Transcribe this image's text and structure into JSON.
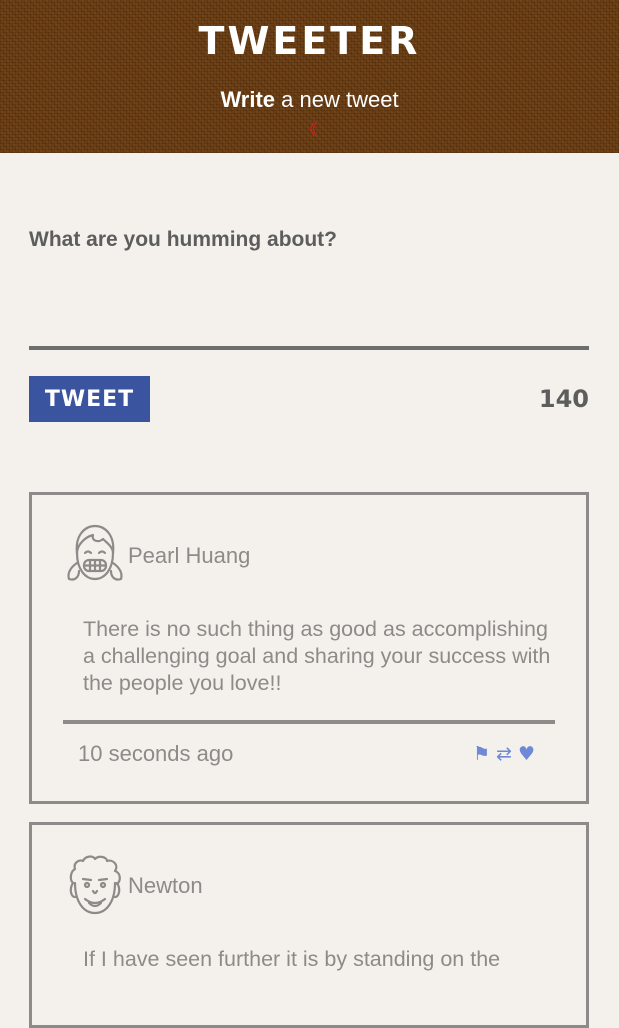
{
  "app": {
    "title": "TWEETER"
  },
  "compose_toggle": {
    "bold": "Write",
    "rest": " a new tweet",
    "arrow_icon": "chevron-double-down"
  },
  "composer": {
    "prompt": "What are you humming about?",
    "placeholder": "",
    "value": "",
    "submit_label": "TWEET",
    "counter": "140"
  },
  "colors": {
    "header_bg": "#6b3d12",
    "page_bg": "#f4f1ec",
    "button_bg": "#3b54a0",
    "action_icon": "#6f89d6",
    "arrow": "#e11d1d",
    "card_border": "#8d8b89"
  },
  "tweets": [
    {
      "author": "Pearl Huang",
      "avatar_icon": "girl-avatar-icon",
      "text": "There is no such thing as good as accomplishing a challenging goal and sharing your success with the people you love!!",
      "time": "10 seconds ago",
      "actions": [
        "flag-icon",
        "retweet-icon",
        "heart-icon"
      ]
    },
    {
      "author": "Newton",
      "avatar_icon": "newton-avatar-icon",
      "text": "If I have seen further it is by standing on the",
      "time": "",
      "actions": []
    }
  ]
}
